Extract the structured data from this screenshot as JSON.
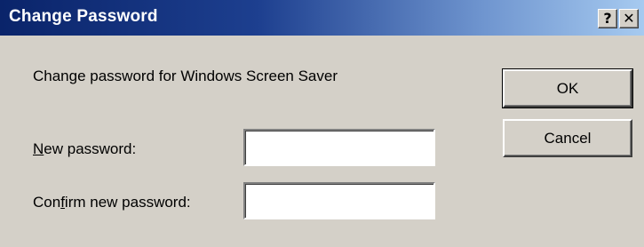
{
  "window": {
    "title": "Change Password",
    "help_glyph": "?",
    "close_glyph": "✕",
    "icons": [
      "help-icon",
      "close-icon"
    ]
  },
  "prompt": "Change password for Windows Screen Saver",
  "fields": {
    "new_password": {
      "label_accel": "N",
      "label_rest": "ew password:",
      "value": ""
    },
    "confirm_password": {
      "label_pre": "Con",
      "label_accel": "f",
      "label_post": "irm new password:",
      "value": ""
    }
  },
  "buttons": {
    "ok_label": "OK",
    "cancel_label": "Cancel"
  },
  "colors": {
    "titlebar_start": "#0a246a",
    "titlebar_end": "#a6caf0",
    "dialog_face": "#d4d0c8"
  }
}
